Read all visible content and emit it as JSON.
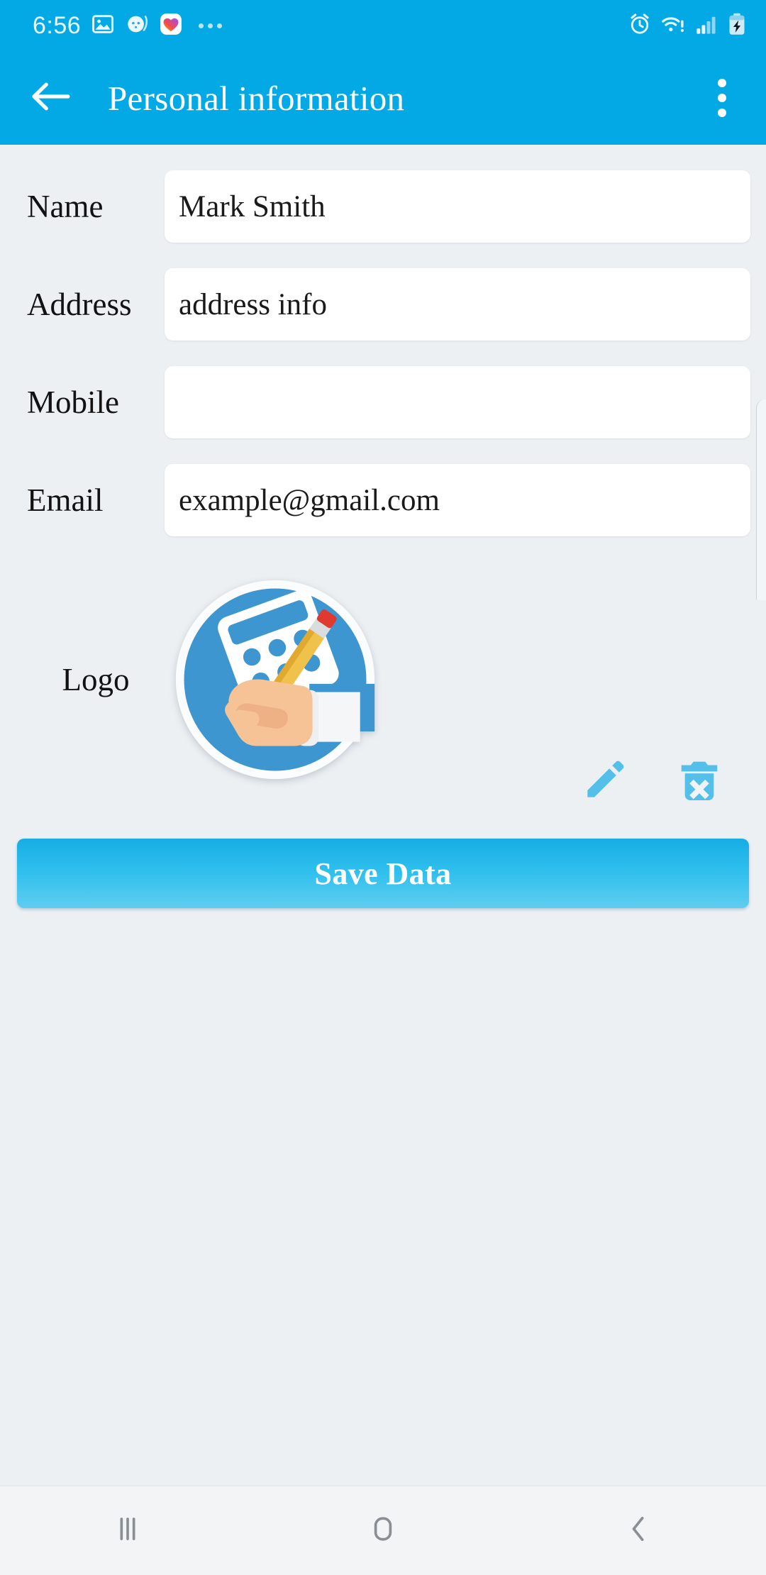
{
  "status_bar": {
    "time": "6:56",
    "left_icons": [
      "gallery-icon",
      "baby-monitor-icon",
      "heart-app-icon",
      "more-notifications-icon"
    ],
    "right_icons": [
      "alarm-icon",
      "wifi-warning-icon",
      "cellular-signal-icon",
      "battery-charging-icon"
    ]
  },
  "app_bar": {
    "title": "Personal information",
    "back_icon": "back-arrow-icon",
    "overflow_icon": "overflow-menu-icon"
  },
  "form": {
    "fields": [
      {
        "label": "Name",
        "value": "Mark Smith",
        "placeholder": ""
      },
      {
        "label": "Address",
        "value": "address info",
        "placeholder": ""
      },
      {
        "label": "Mobile",
        "value": "",
        "placeholder": ""
      },
      {
        "label": "Email",
        "value": "example@gmail.com",
        "placeholder": ""
      }
    ]
  },
  "logo_section": {
    "label": "Logo",
    "image_name": "hand-writing-calculator-logo",
    "edit_icon": "pencil-edit-icon",
    "delete_icon": "trash-delete-icon"
  },
  "actions": {
    "save_label": "Save Data"
  },
  "nav_bar": {
    "recents_icon": "recents-icon",
    "home_icon": "home-icon",
    "back_icon": "back-chevron-icon"
  },
  "colors": {
    "primary": "#03A9E4",
    "background": "#ECF0F3",
    "field_bg": "#FFFFFF",
    "accent_icon": "#54C0EA",
    "logo_blue": "#3D96CF"
  }
}
